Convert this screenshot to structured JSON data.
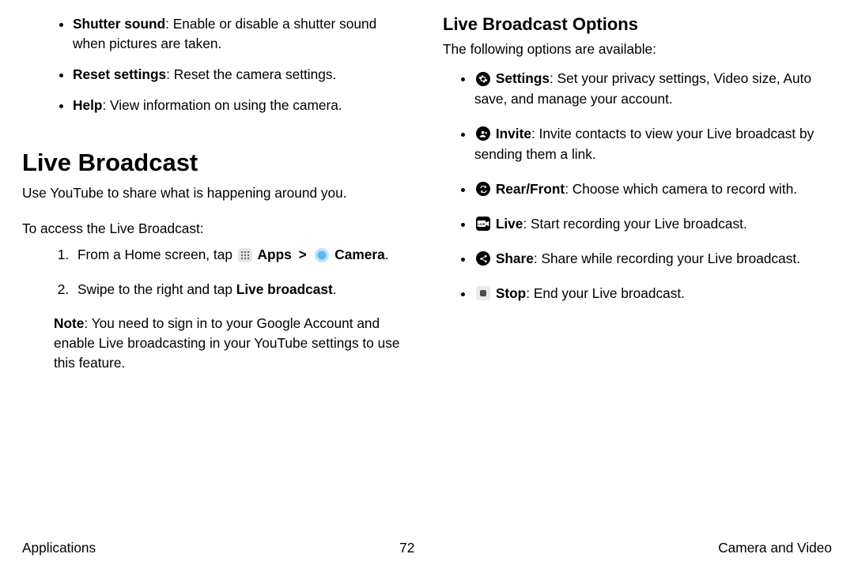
{
  "left": {
    "settings_list": [
      {
        "title": "Shutter sound",
        "desc": ": Enable or disable a shutter sound when pictures are taken."
      },
      {
        "title": "Reset settings",
        "desc": ": Reset the camera settings."
      },
      {
        "title": "Help",
        "desc": ": View information on using the camera."
      }
    ],
    "heading": "Live Broadcast",
    "intro": "Use YouTube to share what is happening around you.",
    "access_label": "To access the Live Broadcast:",
    "step1_prefix": "From a Home screen, tap ",
    "apps_label": "Apps",
    "separator": ">",
    "camera_label": "Camera",
    "step1_suffix": ".",
    "step2_text_a": "Swipe to the right and tap ",
    "step2_bold": "Live broadcast",
    "step2_suffix": ".",
    "note_label": "Note",
    "note_body": ": You need to sign in to your Google Account and enable Live broadcasting in your YouTube settings to use this feature."
  },
  "right": {
    "heading": "Live Broadcast Options",
    "intro": "The following options are available:",
    "items": [
      {
        "title": "Settings",
        "desc": ": Set your privacy settings, Video size, Auto save, and manage your account."
      },
      {
        "title": "Invite",
        "desc": ": Invite contacts to view your Live broadcast by sending them a link."
      },
      {
        "title": "Rear/Front",
        "desc": ": Choose which camera to record with."
      },
      {
        "title": "Live",
        "desc": ": Start recording your Live broadcast."
      },
      {
        "title": "Share",
        "desc": ": Share while recording your Live broadcast."
      },
      {
        "title": "Stop",
        "desc": ": End your Live broadcast."
      }
    ]
  },
  "footer": {
    "left": "Applications",
    "center": "72",
    "right": "Camera and Video"
  }
}
